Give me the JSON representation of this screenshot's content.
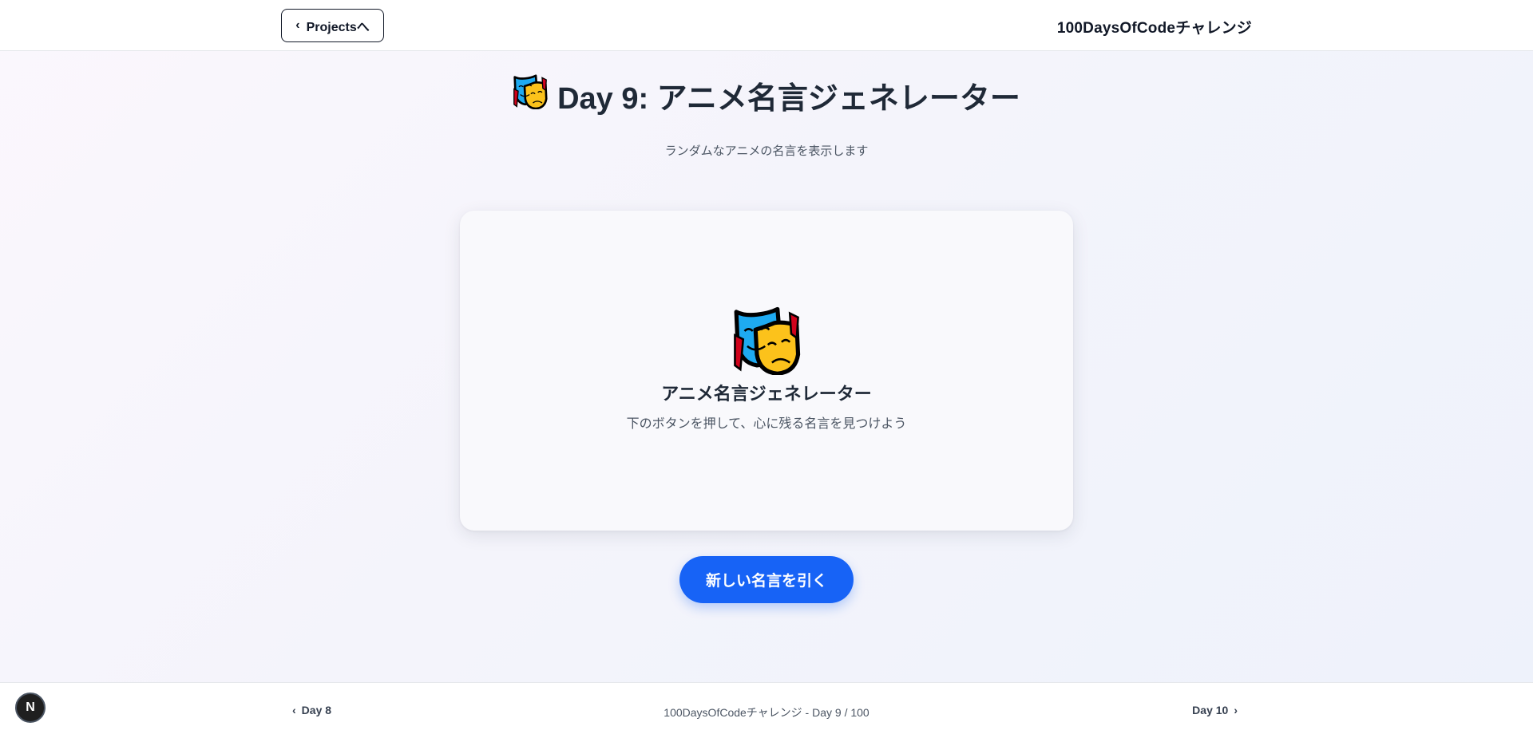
{
  "header": {
    "back_label": "Projectsへ",
    "brand": "100DaysOfCodeチャレンジ"
  },
  "page": {
    "title": "Day 9: アニメ名言ジェネレーター",
    "subtitle": "ランダムなアニメの名言を表示します",
    "title_icon": "performing-arts-icon"
  },
  "card": {
    "icon": "performing-arts-icon",
    "title": "アニメ名言ジェネレーター",
    "description": "下のボタンを押して、心に残る名言を見つけよう"
  },
  "action": {
    "button_label": "新しい名言を引く"
  },
  "footer": {
    "prev_label": "Day 8",
    "progress": "100DaysOfCodeチャレンジ - Day 9 / 100",
    "next_label": "Day 10"
  },
  "badge": {
    "letter": "N"
  },
  "colors": {
    "primary": "#1763f6",
    "text": "#1f2937",
    "muted": "#4b5563",
    "mask_blue": "#1eaaf1",
    "mask_yellow": "#fcc21b",
    "ribbon_red": "#d0021b"
  }
}
